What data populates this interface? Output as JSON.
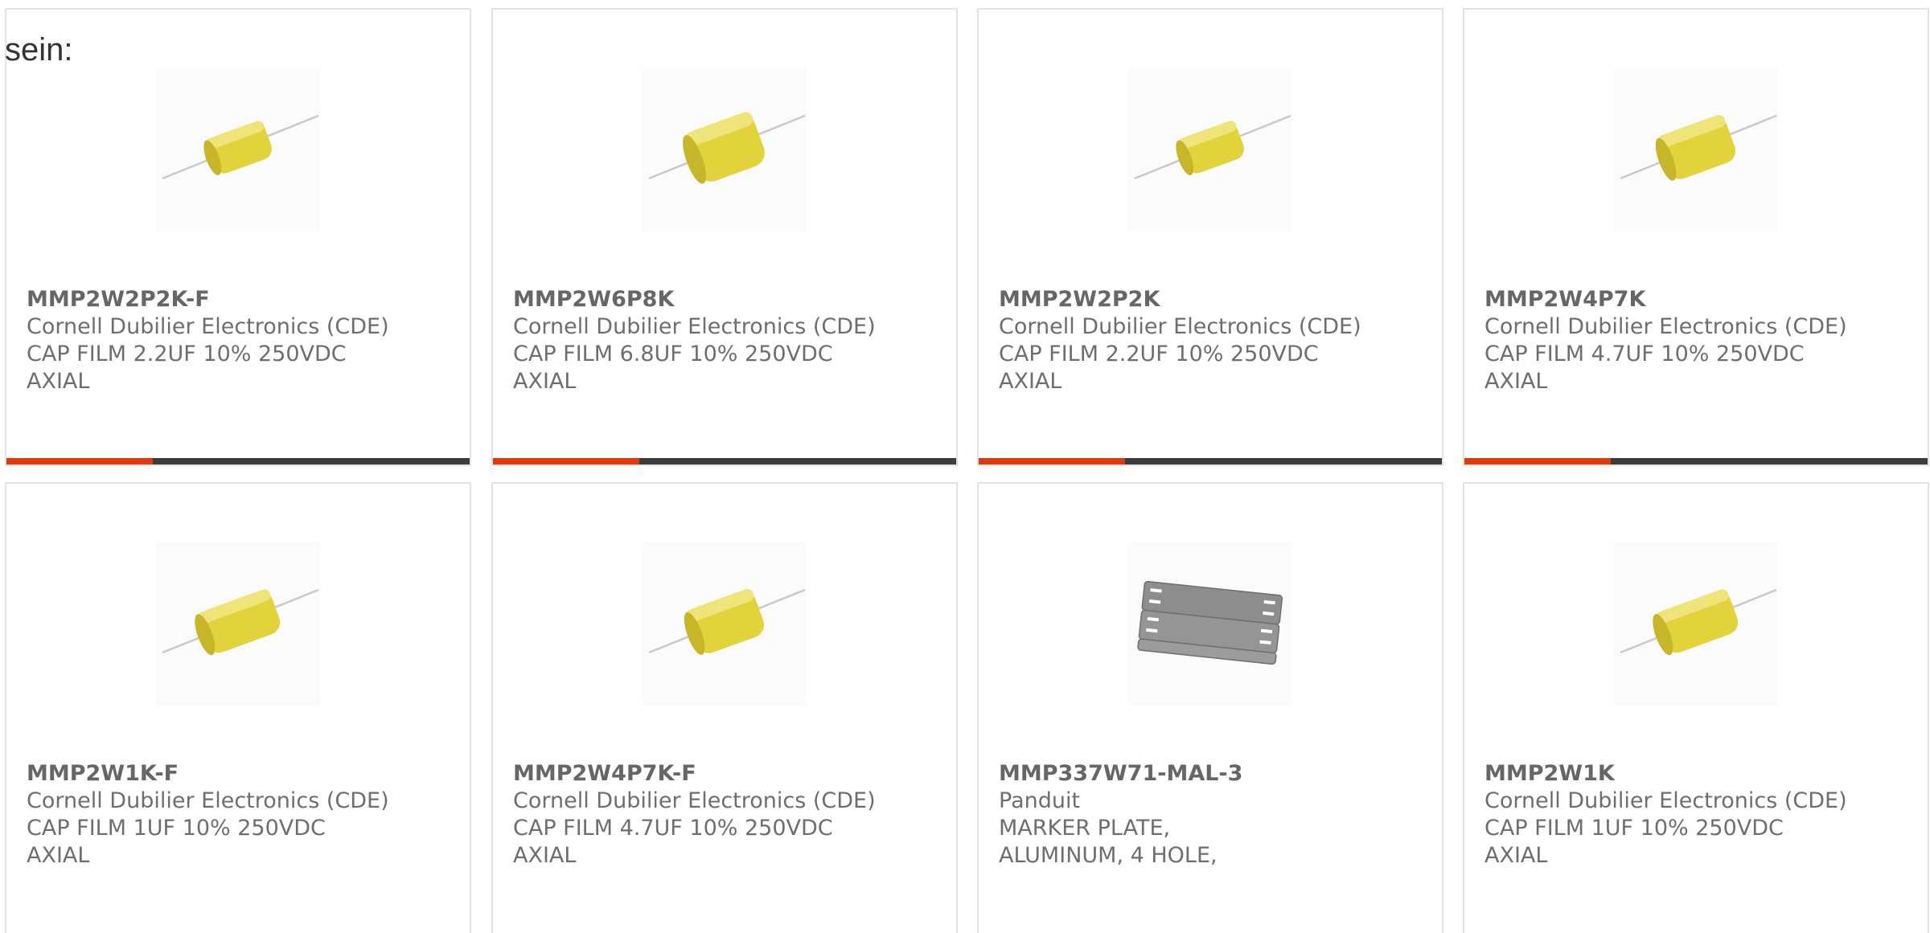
{
  "lead_text": "sein:",
  "colors": {
    "accent_bar": "#e0390c",
    "dark_bar": "#3c3c3c",
    "capacitor_body": "#e5d63a",
    "plate": "#8a8a8a"
  },
  "products": [
    {
      "part": "MMP2W2P2K-F",
      "manufacturer": "Cornell Dubilier Electronics (CDE)",
      "description": "CAP FILM 2.2UF 10% 250VDC AXIAL",
      "image_icon": "film-capacitor-icon"
    },
    {
      "part": "MMP2W6P8K",
      "manufacturer": "Cornell Dubilier Electronics (CDE)",
      "description": "CAP FILM 6.8UF 10% 250VDC AXIAL",
      "image_icon": "film-capacitor-icon"
    },
    {
      "part": "MMP2W2P2K",
      "manufacturer": "Cornell Dubilier Electronics (CDE)",
      "description": "CAP FILM 2.2UF 10% 250VDC AXIAL",
      "image_icon": "film-capacitor-icon"
    },
    {
      "part": "MMP2W4P7K",
      "manufacturer": "Cornell Dubilier Electronics (CDE)",
      "description": "CAP FILM 4.7UF 10% 250VDC AXIAL",
      "image_icon": "film-capacitor-icon"
    },
    {
      "part": "MMP2W1K-F",
      "manufacturer": "Cornell Dubilier Electronics (CDE)",
      "description": "CAP FILM 1UF 10% 250VDC AXIAL",
      "image_icon": "film-capacitor-icon"
    },
    {
      "part": "MMP2W4P7K-F",
      "manufacturer": "Cornell Dubilier Electronics (CDE)",
      "description": "CAP FILM 4.7UF 10% 250VDC AXIAL",
      "image_icon": "film-capacitor-icon"
    },
    {
      "part": "MMP337W71-MAL-3",
      "manufacturer": "Panduit",
      "description": "MARKER PLATE, ALUMINUM, 4 HOLE,",
      "image_icon": "marker-plate-icon"
    },
    {
      "part": "MMP2W1K",
      "manufacturer": "Cornell Dubilier Electronics (CDE)",
      "description": "CAP FILM 1UF 10% 250VDC AXIAL",
      "image_icon": "film-capacitor-icon"
    }
  ]
}
